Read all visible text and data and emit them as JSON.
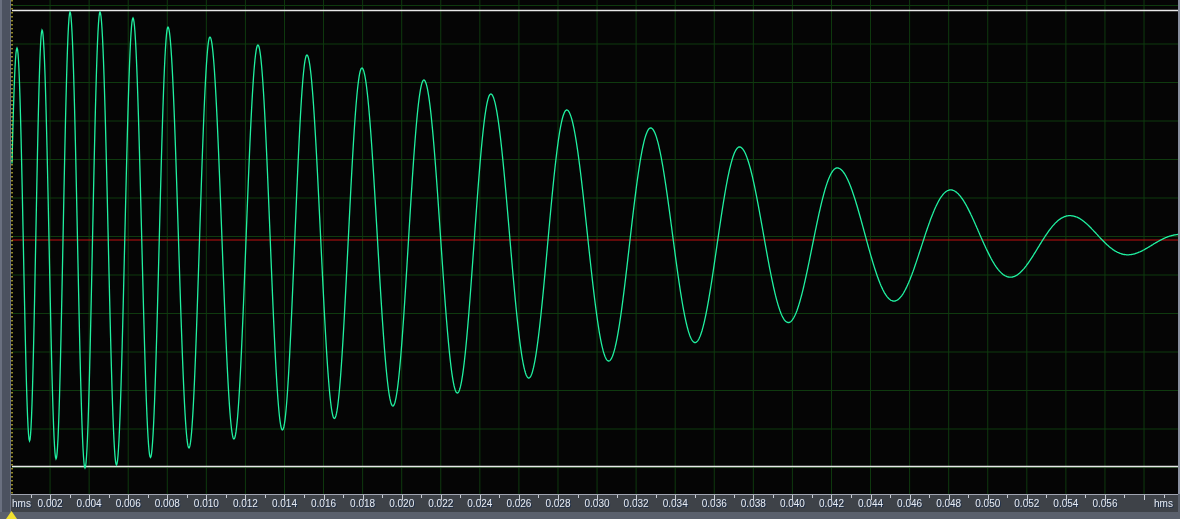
{
  "time_ruler": {
    "unit_label_left": "hms",
    "unit_label_right": "hms",
    "ticks": [
      "0.002",
      "0.004",
      "0.006",
      "0.008",
      "0.010",
      "0.012",
      "0.014",
      "0.016",
      "0.018",
      "0.020",
      "0.022",
      "0.024",
      "0.026",
      "0.028",
      "0.030",
      "0.032",
      "0.034",
      "0.036",
      "0.038",
      "0.040",
      "0.042",
      "0.044",
      "0.046",
      "0.048",
      "0.050",
      "0.052",
      "0.054",
      "0.056"
    ]
  }
}
